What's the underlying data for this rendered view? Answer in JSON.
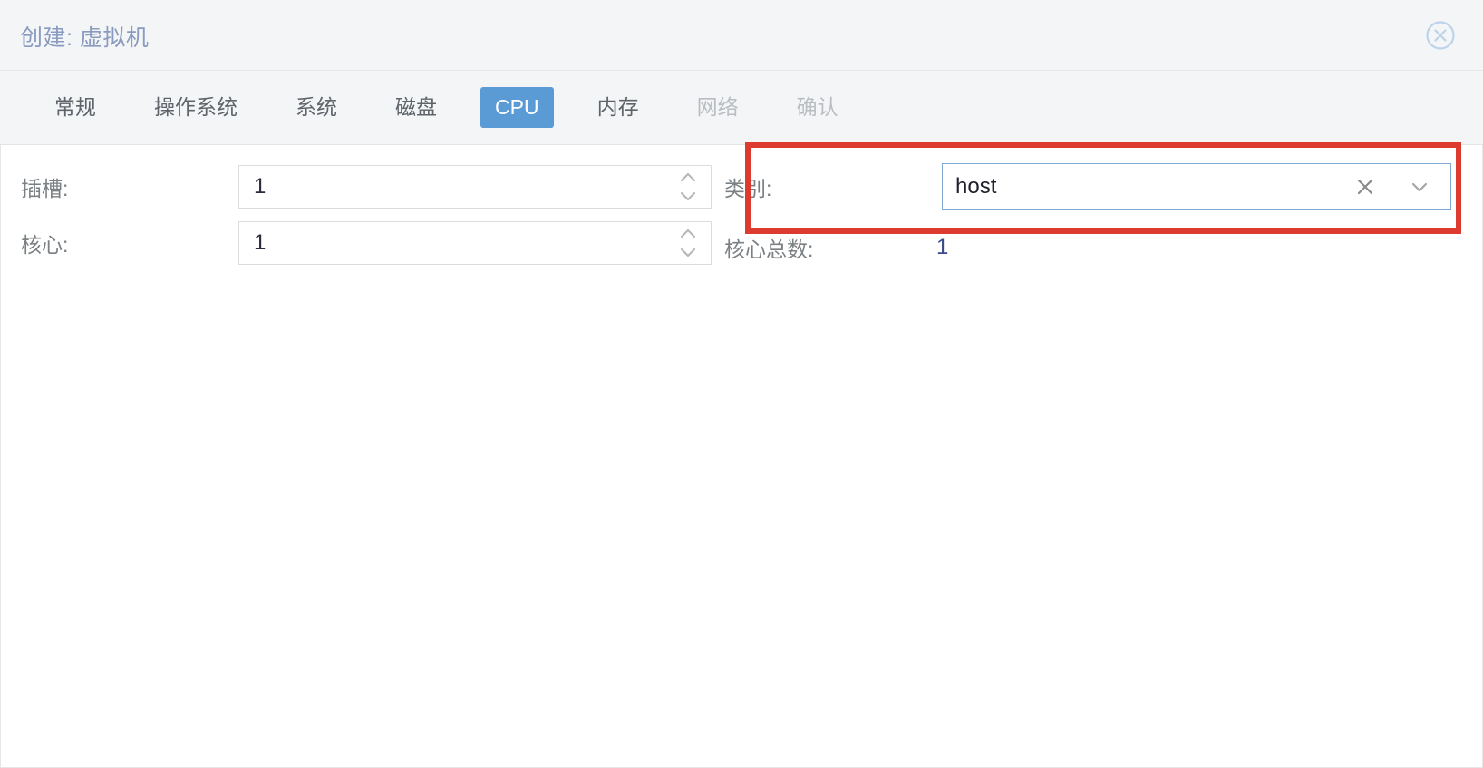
{
  "window": {
    "title": "创建: 虚拟机",
    "close_icon": "close-circle-icon"
  },
  "tabs": [
    {
      "label": "常规",
      "state": "enabled"
    },
    {
      "label": "操作系统",
      "state": "enabled"
    },
    {
      "label": "系统",
      "state": "enabled"
    },
    {
      "label": "磁盘",
      "state": "enabled"
    },
    {
      "label": "CPU",
      "state": "active"
    },
    {
      "label": "内存",
      "state": "enabled"
    },
    {
      "label": "网络",
      "state": "disabled"
    },
    {
      "label": "确认",
      "state": "disabled"
    }
  ],
  "form": {
    "sockets": {
      "label": "插槽:",
      "value": "1",
      "spinner_icon": "spinner-updown-icon"
    },
    "cores": {
      "label": "核心:",
      "value": "1",
      "spinner_icon": "spinner-updown-icon"
    },
    "type": {
      "label": "类别:",
      "value": "host",
      "clear_icon": "clear-x-icon",
      "arrow_icon": "chevron-down-icon"
    },
    "total_cores": {
      "label": "核心总数:",
      "value": "1"
    }
  },
  "colors": {
    "accent_blue": "#5b9bd5",
    "title_blue": "#8a9bc0",
    "highlight_red": "#dd3b30",
    "combo_border_blue": "#7fa8d4",
    "header_bg": "#f4f5f6",
    "value_blue": "#3a4a8c"
  }
}
